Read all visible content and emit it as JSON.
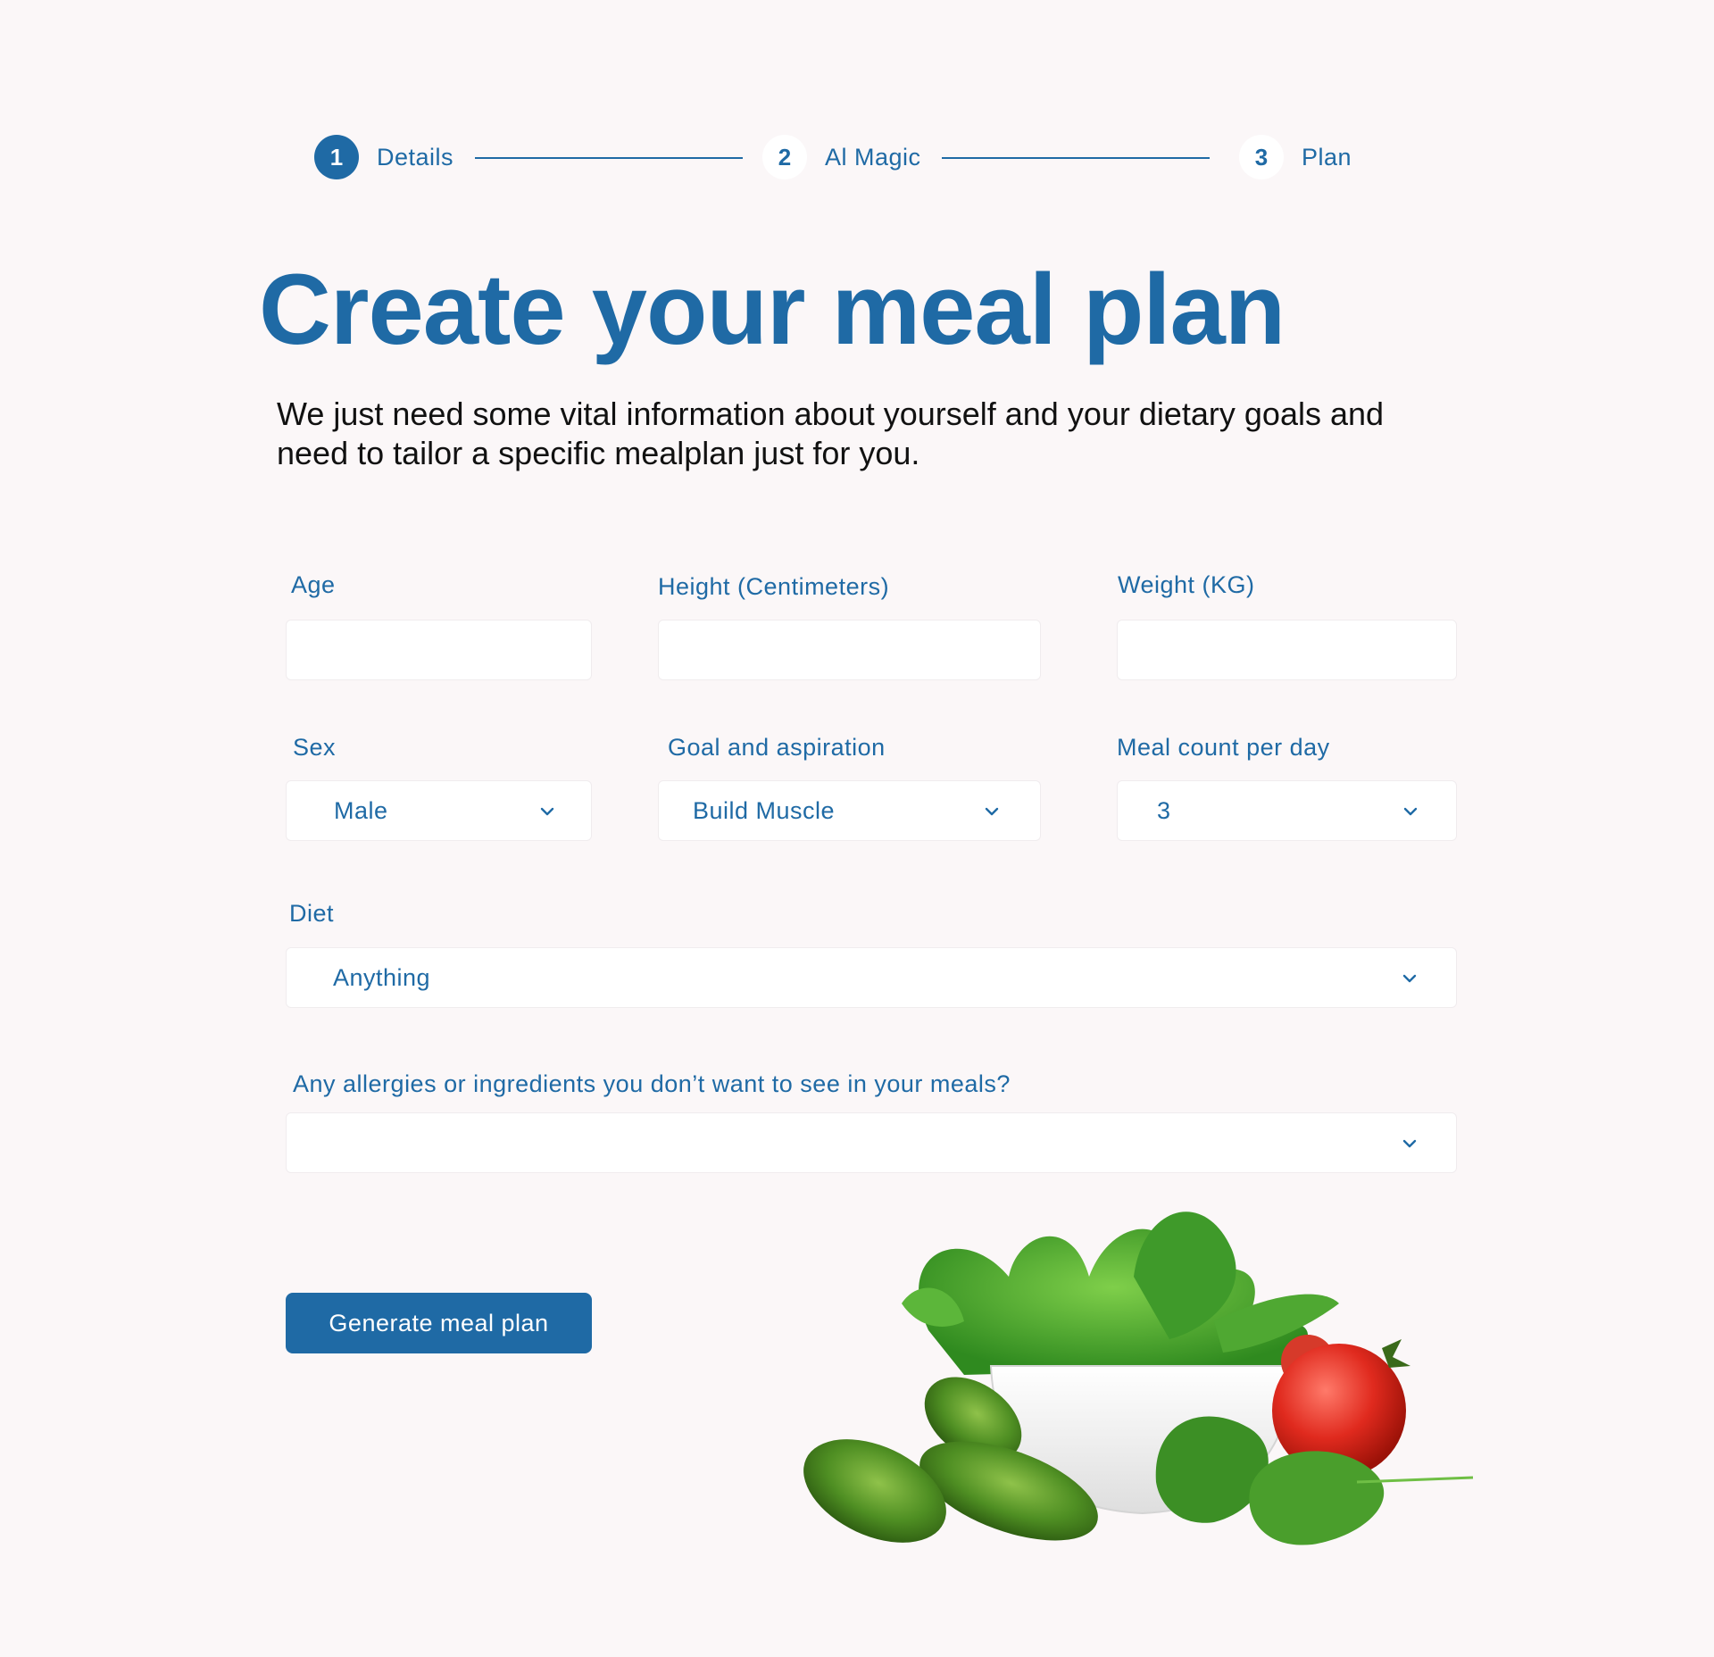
{
  "stepper": {
    "steps": [
      {
        "number": "1",
        "label": "Details",
        "state": "active"
      },
      {
        "number": "2",
        "label": "Al Magic",
        "state": "inactive"
      },
      {
        "number": "3",
        "label": "Plan",
        "state": "inactive"
      }
    ]
  },
  "header": {
    "title": "Create your meal plan",
    "subtitle": "We just need  some vital information about yourself and your dietary goals and need to tailor a specific mealplan just for you."
  },
  "form": {
    "age": {
      "label": "Age",
      "value": ""
    },
    "height": {
      "label": "Height (Centimeters)",
      "value": ""
    },
    "weight": {
      "label": "Weight (KG)",
      "value": ""
    },
    "sex": {
      "label": "Sex",
      "value": "Male"
    },
    "goal": {
      "label": "Goal and aspiration",
      "value": "Build Muscle"
    },
    "meal_count": {
      "label": "Meal count per day",
      "value": "3"
    },
    "diet": {
      "label": "Diet",
      "value": "Anything"
    },
    "allergies": {
      "label": "Any allergies or ingredients you don’t want to see in your meals?",
      "value": ""
    },
    "submit_label": "Generate meal plan"
  },
  "colors": {
    "accent": "#1f6aa5",
    "background": "#fbf7f8",
    "field": "#ffffff"
  },
  "icons": {
    "select_chevron": "chevron-down-icon",
    "illustration": "vegetables-bowl-illustration"
  }
}
